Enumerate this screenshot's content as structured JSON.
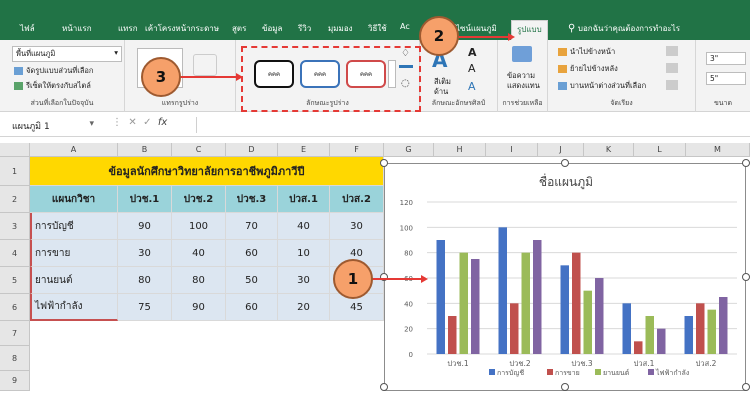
{
  "ribbon_tabs": [
    "ไฟล์",
    "หน้าแรก",
    "แทรก",
    "เค้าโครงหน้ากระดาษ",
    "สูตร",
    "ข้อมูล",
    "รีวิว",
    "มุมมอง",
    "วิธีใช้",
    "Ac",
    "ไซน์แผนภูมิ",
    "รูปแบบ"
  ],
  "tell_me": "บอกฉันว่าคุณต้องการทำอะไร",
  "ribbon": {
    "current_selection": {
      "combo": "พื้นที่แผนภูมิ",
      "format_selection": "จัดรูปแบบส่วนที่เลือก",
      "reset": "รีเซ็ตให้ตรงกับสไตล์",
      "label": "ส่วนที่เลือกในปัจจุบัน"
    },
    "insert_shapes": {
      "label": "แทรกรูปร่าง"
    },
    "shape_styles": {
      "label": "ลักษณะรูปร่าง",
      "style_text": "คคค"
    },
    "wordart": {
      "fill": "สีเติม",
      "outline": "ด้าน",
      "label": "ลักษณะอักษรศิลป์"
    },
    "alt_text": {
      "line1": "ข้อความ",
      "line2": "แสดงแทน",
      "label": "การช่วยเหลือ"
    },
    "arrange": {
      "forward": "นำไปข้างหน้า",
      "backward": "ย้ายไปข้างหลัง",
      "pane": "บานหน้าต่างส่วนที่เลือก",
      "label": "จัดเรียง"
    },
    "size": {
      "height": "3\"",
      "width": "5\"",
      "label": "ขนาด"
    }
  },
  "formula_bar": {
    "name_box": "แผนภูมิ 1",
    "fx": "fx"
  },
  "columns": [
    "A",
    "B",
    "C",
    "D",
    "E",
    "F",
    "G",
    "H",
    "I",
    "J",
    "K",
    "L",
    "M"
  ],
  "rows": [
    "1",
    "2",
    "3",
    "4",
    "5",
    "6",
    "7",
    "8",
    "9"
  ],
  "sheet": {
    "title": "ข้อมูลนักศึกษาวิทยาลัยการอาชีพภูมิภาวีปี",
    "header": [
      "แผนกวิชา",
      "ปวช.1",
      "ปวช.2",
      "ปวช.3",
      "ปวส.1",
      "ปวส.2"
    ],
    "data": [
      [
        "การบัญชี",
        "90",
        "100",
        "70",
        "40",
        "30"
      ],
      [
        "การขาย",
        "30",
        "40",
        "60",
        "10",
        "40"
      ],
      [
        "ยานยนต์",
        "80",
        "80",
        "50",
        "30",
        "35"
      ],
      [
        "ไฟฟ้ากำลัง",
        "75",
        "90",
        "60",
        "20",
        "45"
      ]
    ]
  },
  "chart_data": {
    "type": "bar",
    "title": "ชื่อแผนภูมิ",
    "categories": [
      "ปวช.1",
      "ปวช.2",
      "ปวช.3",
      "ปวส.1",
      "ปวส.2"
    ],
    "series": [
      {
        "name": "การบัญชี",
        "values": [
          90,
          100,
          70,
          40,
          30
        ],
        "color": "#4472c4"
      },
      {
        "name": "การขาย",
        "values": [
          30,
          40,
          80,
          10,
          40
        ],
        "color": "#c0504d"
      },
      {
        "name": "ยานยนต์",
        "values": [
          80,
          80,
          50,
          30,
          35
        ],
        "color": "#9bbb59"
      },
      {
        "name": "ไฟฟ้ากำลัง",
        "values": [
          75,
          90,
          60,
          20,
          45
        ],
        "color": "#8064a2"
      }
    ],
    "ylim": [
      0,
      120
    ],
    "yticks": [
      "0",
      "20",
      "40",
      "60",
      "80",
      "100",
      "120"
    ],
    "legend": "bottom",
    "grid": true
  },
  "callouts": [
    "1",
    "2",
    "3"
  ],
  "colors": {
    "excel_green": "#217346",
    "title_fill": "#ffd800",
    "header_fill": "#9ad3da",
    "data_fill": "#dce6f1",
    "callout_fill": "#f6a06a",
    "dash_red": "#e53935"
  }
}
